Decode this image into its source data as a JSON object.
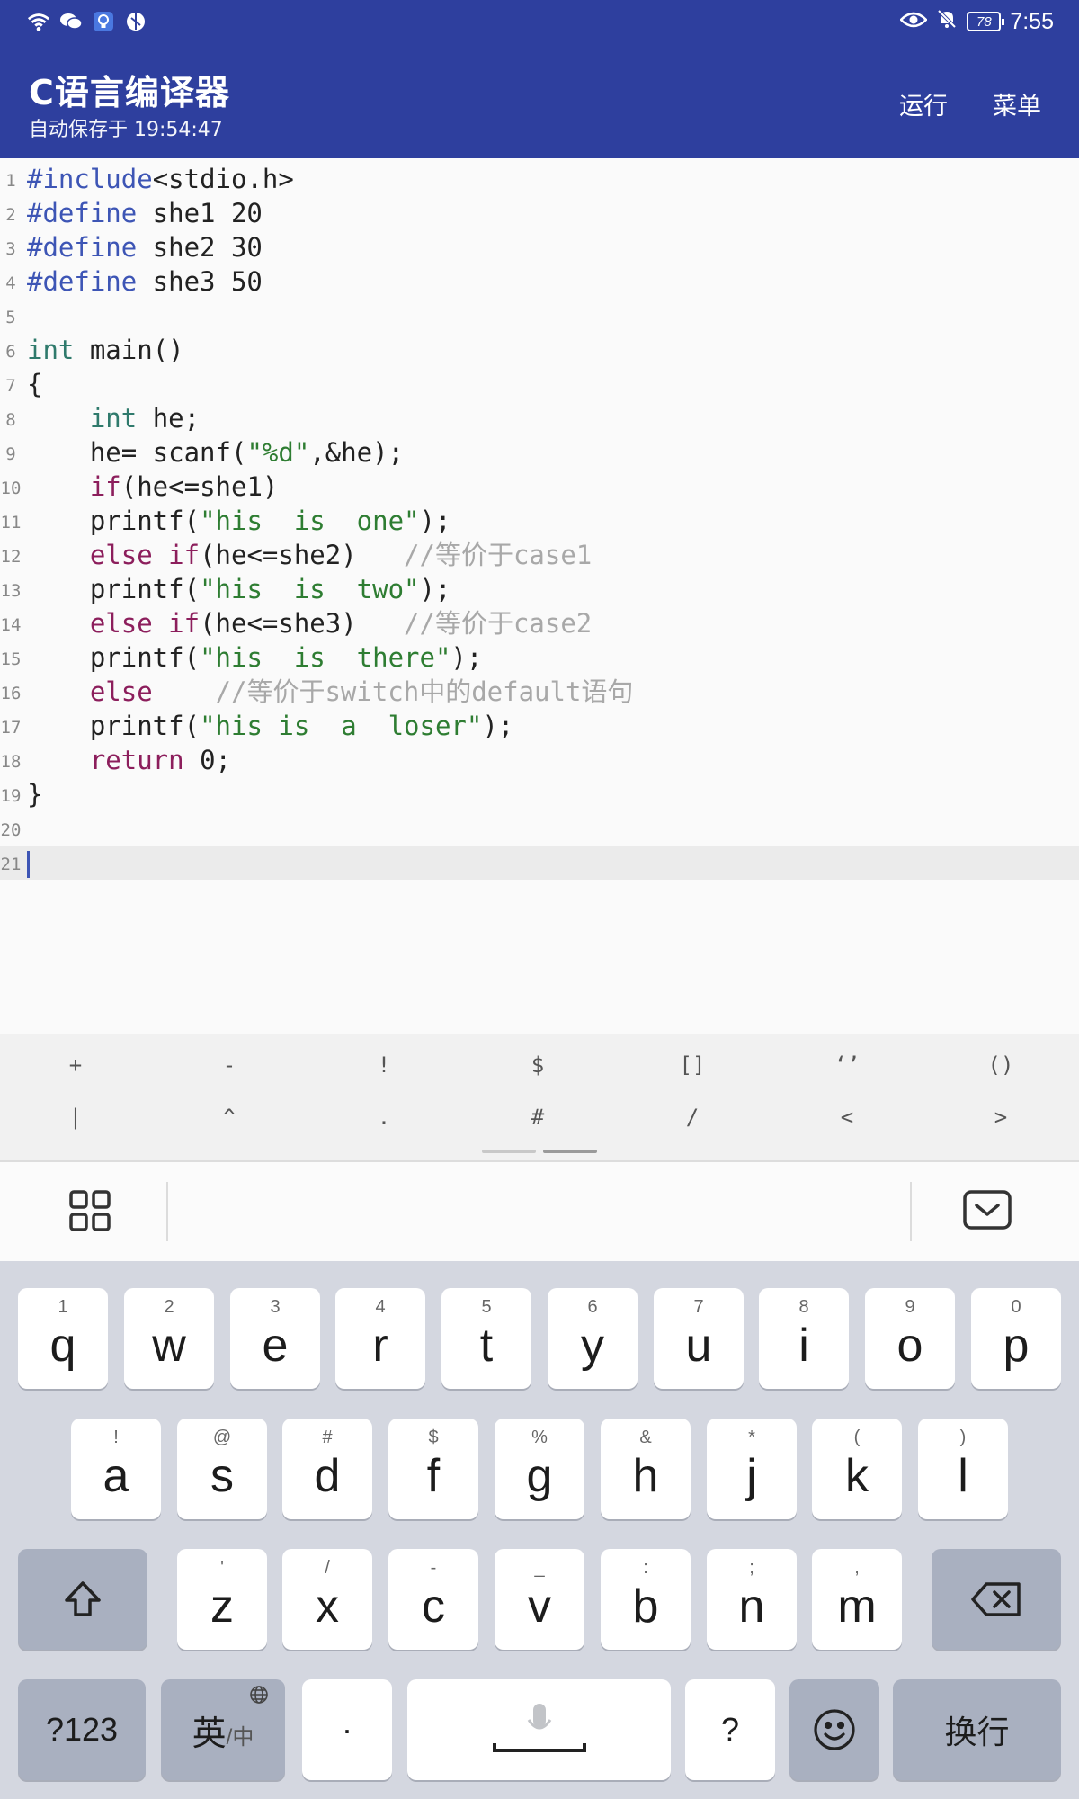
{
  "status_bar": {
    "icons": [
      "wifi-icon",
      "wechat-icon",
      "bulb-icon",
      "app-icon"
    ],
    "battery": "78",
    "time": "7:55"
  },
  "app_bar": {
    "title": "C语言编译器",
    "subtitle": "自动保存于 19:54:47",
    "run_label": "运行",
    "menu_label": "菜单"
  },
  "editor": {
    "current_line": 21,
    "lines": [
      {
        "n": "1",
        "tokens": [
          {
            "t": "#include",
            "c": "pre"
          },
          {
            "t": "<stdio.h>",
            "c": "plain"
          }
        ]
      },
      {
        "n": "2",
        "tokens": [
          {
            "t": "#define",
            "c": "pre"
          },
          {
            "t": " she1 20",
            "c": "plain"
          }
        ]
      },
      {
        "n": "3",
        "tokens": [
          {
            "t": "#define",
            "c": "pre"
          },
          {
            "t": " she2 30",
            "c": "plain"
          }
        ]
      },
      {
        "n": "4",
        "tokens": [
          {
            "t": "#define",
            "c": "pre"
          },
          {
            "t": " she3 50",
            "c": "plain"
          }
        ]
      },
      {
        "n": "5",
        "tokens": []
      },
      {
        "n": "6",
        "tokens": [
          {
            "t": "int",
            "c": "type"
          },
          {
            "t": " main()",
            "c": "plain"
          }
        ]
      },
      {
        "n": "7",
        "tokens": [
          {
            "t": "{",
            "c": "plain"
          }
        ]
      },
      {
        "n": "8",
        "tokens": [
          {
            "t": "    ",
            "c": "plain"
          },
          {
            "t": "int",
            "c": "type"
          },
          {
            "t": " he;",
            "c": "plain"
          }
        ]
      },
      {
        "n": "9",
        "tokens": [
          {
            "t": "    he= scanf(",
            "c": "plain"
          },
          {
            "t": "\"%d\"",
            "c": "str"
          },
          {
            "t": ",&he);",
            "c": "plain"
          }
        ]
      },
      {
        "n": "10",
        "tokens": [
          {
            "t": "    ",
            "c": "plain"
          },
          {
            "t": "if",
            "c": "kw"
          },
          {
            "t": "(he<=she1)",
            "c": "plain"
          }
        ]
      },
      {
        "n": "11",
        "tokens": [
          {
            "t": "    printf(",
            "c": "plain"
          },
          {
            "t": "\"his  is  one\"",
            "c": "str"
          },
          {
            "t": ");",
            "c": "plain"
          }
        ]
      },
      {
        "n": "12",
        "tokens": [
          {
            "t": "    ",
            "c": "plain"
          },
          {
            "t": "else if",
            "c": "kw"
          },
          {
            "t": "(he<=she2)   ",
            "c": "plain"
          },
          {
            "t": "//等价于case1",
            "c": "cm"
          }
        ]
      },
      {
        "n": "13",
        "tokens": [
          {
            "t": "    printf(",
            "c": "plain"
          },
          {
            "t": "\"his  is  two\"",
            "c": "str"
          },
          {
            "t": ");",
            "c": "plain"
          }
        ]
      },
      {
        "n": "14",
        "tokens": [
          {
            "t": "    ",
            "c": "plain"
          },
          {
            "t": "else if",
            "c": "kw"
          },
          {
            "t": "(he<=she3)   ",
            "c": "plain"
          },
          {
            "t": "//等价于case2",
            "c": "cm"
          }
        ]
      },
      {
        "n": "15",
        "tokens": [
          {
            "t": "    printf(",
            "c": "plain"
          },
          {
            "t": "\"his  is  there\"",
            "c": "str"
          },
          {
            "t": ");",
            "c": "plain"
          }
        ]
      },
      {
        "n": "16",
        "tokens": [
          {
            "t": "    ",
            "c": "plain"
          },
          {
            "t": "else",
            "c": "kw"
          },
          {
            "t": "    ",
            "c": "plain"
          },
          {
            "t": "//等价于switch中的default语句",
            "c": "cm"
          }
        ]
      },
      {
        "n": "17",
        "tokens": [
          {
            "t": "    printf(",
            "c": "plain"
          },
          {
            "t": "\"his is  a  loser\"",
            "c": "str"
          },
          {
            "t": ");",
            "c": "plain"
          }
        ]
      },
      {
        "n": "18",
        "tokens": [
          {
            "t": "    ",
            "c": "plain"
          },
          {
            "t": "return",
            "c": "kw"
          },
          {
            "t": " 0;",
            "c": "plain"
          }
        ]
      },
      {
        "n": "19",
        "tokens": [
          {
            "t": "}",
            "c": "plain"
          }
        ]
      },
      {
        "n": "20",
        "tokens": []
      },
      {
        "n": "21",
        "tokens": []
      }
    ]
  },
  "symbol_bar": {
    "row1": [
      "+",
      "-",
      "!",
      "$",
      "[]",
      "‘’",
      "()"
    ],
    "row2": [
      "|",
      "^",
      ".",
      "#",
      "/",
      "<",
      ">"
    ],
    "page_count": 2,
    "active_page": 2
  },
  "ime_toolbar": {
    "left_icon": "grid-icon",
    "right_icon": "keyboard-hide-icon"
  },
  "keyboard": {
    "row1": [
      {
        "k": "q",
        "h": "1"
      },
      {
        "k": "w",
        "h": "2"
      },
      {
        "k": "e",
        "h": "3"
      },
      {
        "k": "r",
        "h": "4"
      },
      {
        "k": "t",
        "h": "5"
      },
      {
        "k": "y",
        "h": "6"
      },
      {
        "k": "u",
        "h": "7"
      },
      {
        "k": "i",
        "h": "8"
      },
      {
        "k": "o",
        "h": "9"
      },
      {
        "k": "p",
        "h": "0"
      }
    ],
    "row2": [
      {
        "k": "a",
        "h": "!"
      },
      {
        "k": "s",
        "h": "@"
      },
      {
        "k": "d",
        "h": "#"
      },
      {
        "k": "f",
        "h": "$"
      },
      {
        "k": "g",
        "h": "%"
      },
      {
        "k": "h",
        "h": "&"
      },
      {
        "k": "j",
        "h": "*"
      },
      {
        "k": "k",
        "h": "("
      },
      {
        "k": "l",
        "h": ")"
      }
    ],
    "row3": [
      {
        "k": "z",
        "h": "'"
      },
      {
        "k": "x",
        "h": "/"
      },
      {
        "k": "c",
        "h": "-"
      },
      {
        "k": "v",
        "h": "_"
      },
      {
        "k": "b",
        "h": ":"
      },
      {
        "k": "n",
        "h": ";"
      },
      {
        "k": "m",
        "h": ","
      }
    ],
    "shift_icon": "shift-icon",
    "backspace_icon": "backspace-icon",
    "num_label": "?123",
    "lang_label": "英",
    "lang_sub": "/中",
    "globe_icon": "globe-icon",
    "dot_label": "·",
    "mic_icon": "mic-icon",
    "question_label": "?",
    "emoji_icon": "emoji-icon",
    "enter_label": "换行"
  }
}
